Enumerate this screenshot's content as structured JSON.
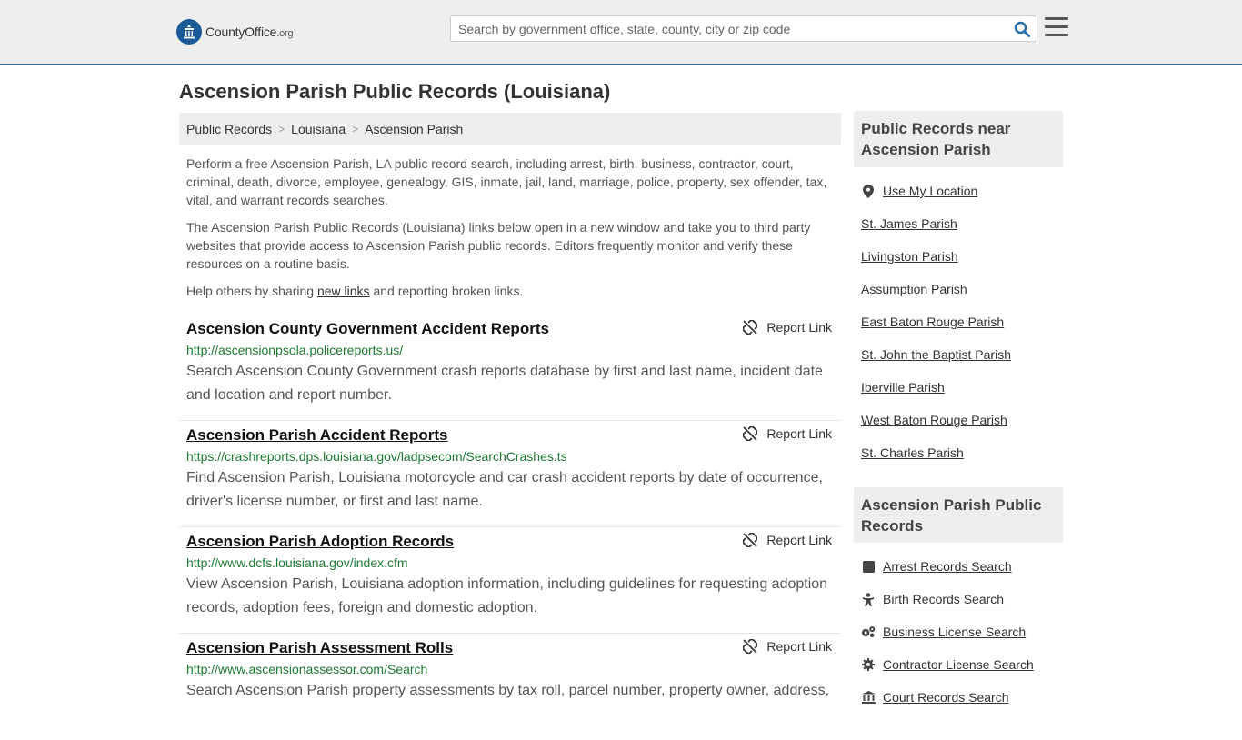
{
  "header": {
    "logo_main": "CountyOffice",
    "logo_org": ".org",
    "search_placeholder": "Search by government office, state, county, city or zip code"
  },
  "page_title": "Ascension Parish Public Records (Louisiana)",
  "breadcrumb": [
    "Public Records",
    "Louisiana",
    "Ascension Parish"
  ],
  "intro": {
    "p1": "Perform a free Ascension Parish, LA public record search, including arrest, birth, business, contractor, court, criminal, death, divorce, employee, genealogy, GIS, inmate, jail, land, marriage, police, property, sex offender, tax, vital, and warrant records searches.",
    "p2": "The Ascension Parish Public Records (Louisiana) links below open in a new window and take you to third party websites that provide access to Ascension Parish public records. Editors frequently monitor and verify these resources on a routine basis.",
    "p3_before": "Help others by sharing ",
    "p3_link": "new links",
    "p3_after": " and reporting broken links."
  },
  "report_label": "Report Link",
  "records": [
    {
      "title": "Ascension County Government Accident Reports",
      "url": "http://ascensionpsola.policereports.us/",
      "desc": "Search Ascension County Government crash reports database by first and last name, incident date and location and report number."
    },
    {
      "title": "Ascension Parish Accident Reports",
      "url": "https://crashreports.dps.louisiana.gov/ladpsecom/SearchCrashes.ts",
      "desc": "Find Ascension Parish, Louisiana motorcycle and car crash accident reports by date of occurrence, driver's license number, or first and last name."
    },
    {
      "title": "Ascension Parish Adoption Records",
      "url": "http://www.dcfs.louisiana.gov/index.cfm",
      "desc": "View Ascension Parish, Louisiana adoption information, including guidelines for requesting adoption records, adoption fees, foreign and domestic adoption."
    },
    {
      "title": "Ascension Parish Assessment Rolls",
      "url": "http://www.ascensionassessor.com/Search",
      "desc": "Search Ascension Parish property assessments by tax roll, parcel number, property owner, address,"
    }
  ],
  "sidebar": {
    "near_title": "Public Records near Ascension Parish",
    "near_items": [
      {
        "label": "Use My Location",
        "icon": "location-pin-icon"
      },
      {
        "label": "St. James Parish"
      },
      {
        "label": "Livingston Parish"
      },
      {
        "label": "Assumption Parish"
      },
      {
        "label": "East Baton Rouge Parish"
      },
      {
        "label": "St. John the Baptist Parish"
      },
      {
        "label": "Iberville Parish"
      },
      {
        "label": "West Baton Rouge Parish"
      },
      {
        "label": "St. Charles Parish"
      }
    ],
    "records_title": "Ascension Parish Public Records",
    "records_items": [
      {
        "label": "Arrest Records Search",
        "icon": "square-icon"
      },
      {
        "label": "Birth Records Search",
        "icon": "baby-icon"
      },
      {
        "label": "Business License Search",
        "icon": "cogs-icon"
      },
      {
        "label": "Contractor License Search",
        "icon": "gear-icon"
      },
      {
        "label": "Court Records Search",
        "icon": "courthouse-icon"
      }
    ]
  },
  "colors": {
    "accent": "#2a6ea6",
    "logo": "#1a5a97",
    "url_green": "#1d7a32",
    "panel_gray": "#eeeeee"
  }
}
